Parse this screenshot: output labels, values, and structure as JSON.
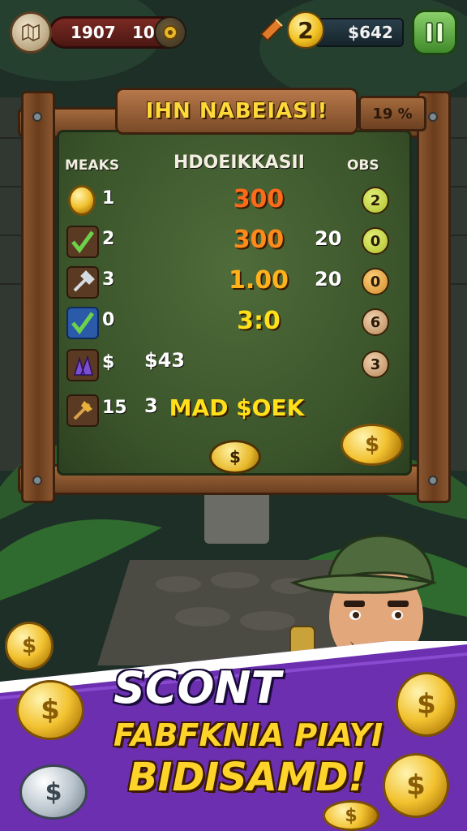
{
  "hud": {
    "stat_a": "1907",
    "stat_b": "10",
    "level": "2",
    "money": "$642"
  },
  "board": {
    "title": "IHN NABEIASI!",
    "timer": "19 %",
    "headers": {
      "left": "MEAKS",
      "center": "HDOEIKKASII",
      "right": "OBS"
    },
    "rows": [
      {
        "num": "1",
        "value": "300",
        "extra": "",
        "right": "",
        "badge": "2",
        "value_color": "#ff6a1a"
      },
      {
        "num": "2",
        "value": "300",
        "extra": "",
        "right": "20",
        "badge": "0",
        "value_color": "#ff8a1a"
      },
      {
        "num": "3",
        "value": "1.00",
        "extra": "",
        "right": "20",
        "badge": "0",
        "value_color": "#ffb21a"
      },
      {
        "num": "0",
        "value": "3:0",
        "extra": "",
        "right": "",
        "badge": "6",
        "value_color": "#ffe01a"
      },
      {
        "num": "$",
        "value": "",
        "extra": "$43",
        "right": "",
        "badge": "3",
        "value_color": "#ffe01a"
      },
      {
        "num": "15",
        "value": "",
        "extra": "3",
        "right": "",
        "badge": "",
        "value_color": "#ffe01a"
      }
    ],
    "row6_label": "MAD $OEK",
    "collect_label": "$"
  },
  "banner": {
    "line1": "SCONT",
    "line2": "FABFKNIA PIAYI",
    "line3": "BIDISAMD!"
  },
  "colors": {
    "banner_purple": "#6b2fb0",
    "felt_green": "#3a532a",
    "wood": "#8a5631",
    "gold": "#f2c230"
  }
}
